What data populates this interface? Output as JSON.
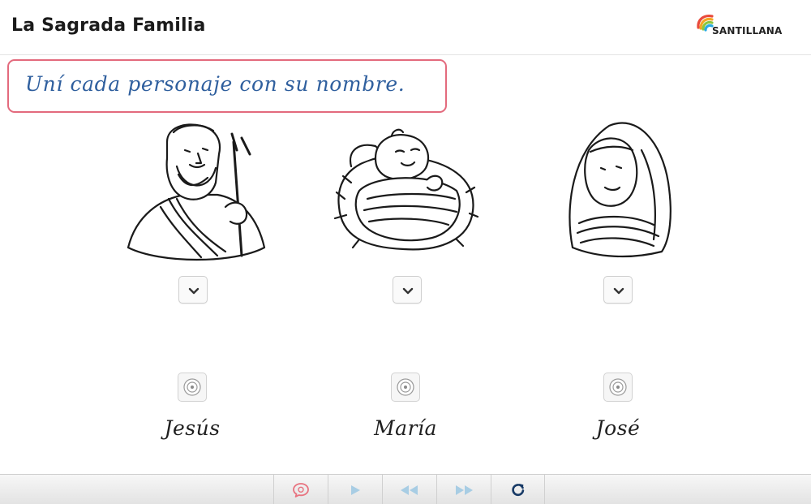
{
  "app": {
    "title": "La Sagrada Familia",
    "brand": "SANTILLANA"
  },
  "instruction": "Uní cada personaje con su nombre.",
  "figures": [
    {
      "icon": "joseph-icon"
    },
    {
      "icon": "baby-jesus-icon"
    },
    {
      "icon": "mary-icon"
    }
  ],
  "names": [
    "Jesús",
    "María",
    "José"
  ],
  "toolbar": {
    "buttons": [
      "feedback-icon",
      "play-icon",
      "rewind-icon",
      "fast-forward-icon",
      "reset-icon"
    ]
  },
  "colors": {
    "instruction_border": "#e36a7d",
    "instruction_text": "#2f5f9e",
    "feedback_icon": "#e8727f",
    "disabled_icon": "#a8cde4",
    "reset_icon": "#183a66"
  }
}
